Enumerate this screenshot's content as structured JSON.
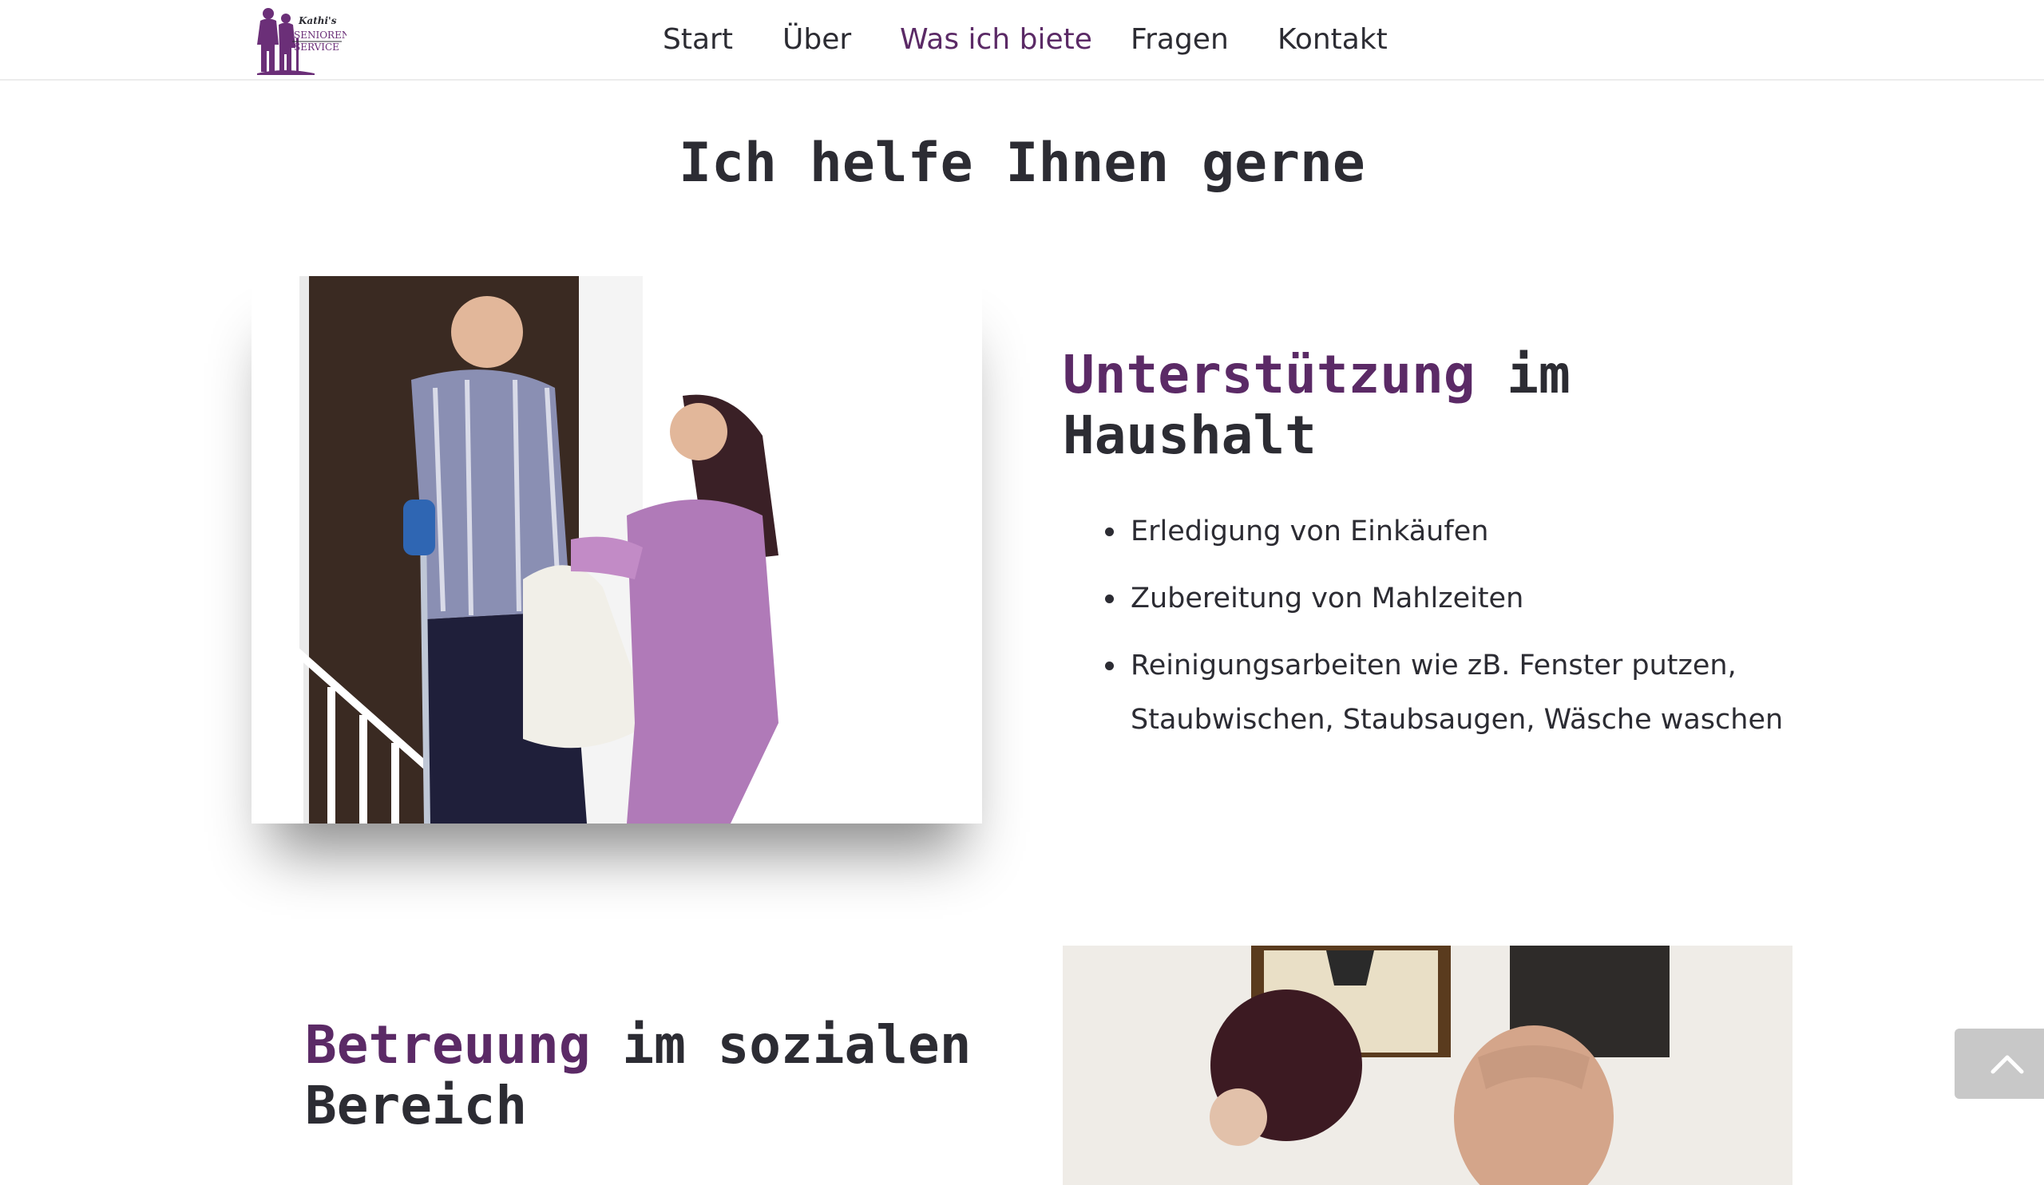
{
  "logo": {
    "line1": "Kathi's",
    "line2": "SENIOREN",
    "line3": "SERVICE"
  },
  "nav": {
    "items": [
      {
        "label": "Start"
      },
      {
        "label": "Über"
      },
      {
        "label": "Was ich biete"
      },
      {
        "label": "Fragen"
      },
      {
        "label": "Kontakt"
      }
    ],
    "active": "Was ich biete"
  },
  "page_heading": "Ich helfe Ihnen gerne",
  "section1": {
    "title_accent": "Unterstützung",
    "title_line1_rest": " im",
    "title_line2": "Haushalt",
    "items": [
      "Erledigung von Einkäufen",
      "Zubereitung von Mahlzeiten",
      "Reinigungsarbeiten wie zB. Fenster putzen, Staubwischen, Staubsaugen, Wäsche waschen"
    ]
  },
  "section2": {
    "title_accent": "Betreuung",
    "title_line1_rest": " im sozialen",
    "title_line2": "Bereich"
  },
  "colors": {
    "accent": "#5b2a66",
    "text": "#2c2c33",
    "scroll_button": "#c8c8c8"
  },
  "icons": {
    "scroll_top": "chevron-up-icon"
  }
}
